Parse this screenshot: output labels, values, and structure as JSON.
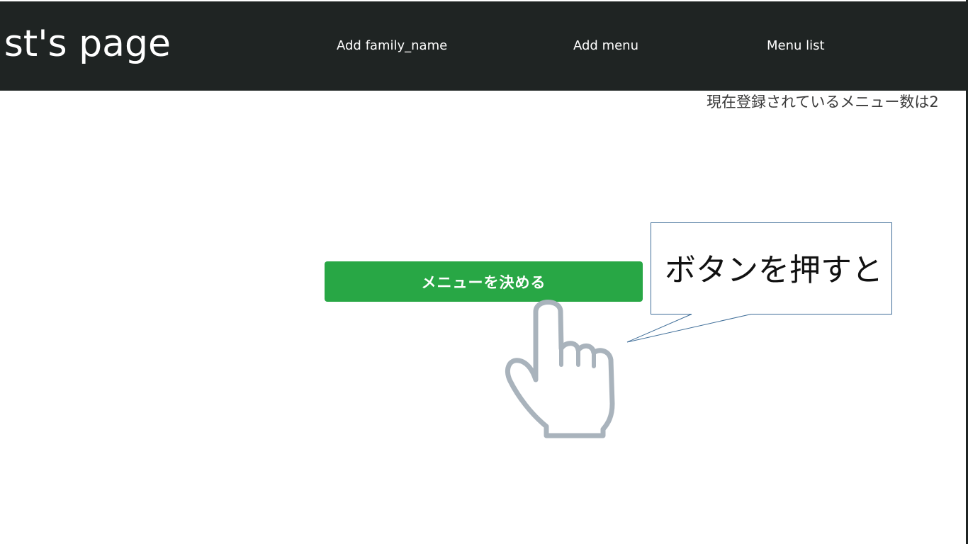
{
  "header": {
    "title": "st's page",
    "nav": {
      "add_family": "Add family_name",
      "add_menu": "Add menu",
      "menu_list": "Menu list"
    }
  },
  "main": {
    "menu_count_text": "現在登録されているメニュー数は2",
    "decide_button_label": "メニューを決める"
  },
  "annotation": {
    "callout_text": "ボタンを押すと",
    "pointer_icon": "pointing-hand-icon"
  },
  "colors": {
    "navbar_background": "#1f2423",
    "button_green": "#28a745",
    "hand_gray": "#a9b3bc",
    "callout_border": "#3e6d98"
  }
}
